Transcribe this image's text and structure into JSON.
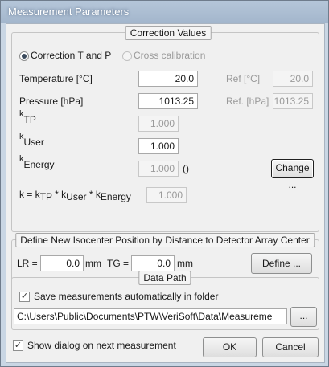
{
  "window": {
    "title": "Measurement Parameters"
  },
  "correction": {
    "legend": "Correction Values",
    "radio_t_and_p": "Correction T and P",
    "radio_cross": "Cross calibration",
    "temperature_label": "Temperature [°C]",
    "temperature_value": "20.0",
    "ref_temp_label": "Ref [°C]",
    "ref_temp_value": "20.0",
    "pressure_label": "Pressure [hPa]",
    "pressure_value": "1013.25",
    "ref_pressure_label": "Ref. [hPa]",
    "ref_pressure_value": "1013.25",
    "k_letter": "k",
    "ktp_sub": "TP",
    "ktp_value": "1.000",
    "kuser_sub": "User",
    "kuser_value": "1.000",
    "kenergy_sub": "Energy",
    "kenergy_value": "1.000",
    "kenergy_unit": "()",
    "change_button": "Change ...",
    "formula_prefix": "k = k",
    "formula_tp": "TP",
    "formula_mul1": " * k",
    "formula_user": "User",
    "formula_mul2": " * k",
    "formula_energy": "Energy",
    "formula_value": "1.000"
  },
  "isocenter": {
    "legend": "Define New Isocenter Position by Distance to Detector Array Center",
    "lr_label": "LR =",
    "lr_value": "0.0",
    "lr_unit": "mm",
    "tg_label": "TG =",
    "tg_value": "0.0",
    "tg_unit": "mm",
    "define_button": "Define ..."
  },
  "data_path": {
    "legend": "Data Path",
    "save_checkbox_label": "Save measurements automatically in folder",
    "save_checked": true,
    "path_value": "C:\\Users\\Public\\Documents\\PTW\\VeriSoft\\Data\\Measureme",
    "browse_button": "..."
  },
  "footer": {
    "show_dialog_label": "Show dialog on next measurement",
    "show_dialog_checked": true,
    "ok_button": "OK",
    "cancel_button": "Cancel"
  }
}
